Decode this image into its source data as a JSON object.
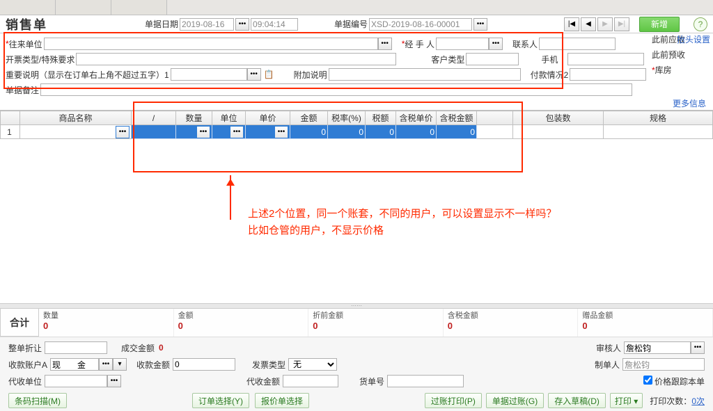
{
  "title": "销售单",
  "header": {
    "date_label": "单据日期",
    "date": "2019-08-16",
    "time": "09:04:14",
    "no_label": "单据编号",
    "no": "XSD-2019-08-16-00001",
    "new_btn": "新增"
  },
  "form": {
    "customer_label": "往来单位",
    "handler_label": "经 手 人",
    "contact_label": "联系人",
    "invoice_label": "开票类型/特殊要求",
    "cust_type_label": "客户类型",
    "phone_label": "手机",
    "important_label": "重要说明（显示在订单右上角不超过五字）1",
    "extra_label": "附加说明",
    "pay_state_label": "付款情况2",
    "note_label": "单据备注",
    "more_info": "更多信息",
    "side_receivable": "此前应收",
    "side_settings": "抬头设置",
    "side_prepaid": "此前预收",
    "side_stock": "库房"
  },
  "grid": {
    "cols": [
      "",
      "商品名称",
      "/",
      "数量",
      "单位",
      "单价",
      "金额",
      "税率(%)",
      "税额",
      "含税单价",
      "含税金额",
      "",
      "包装数",
      "规格"
    ],
    "row1": {
      "idx": "1",
      "amount": "0",
      "tax": "0",
      "tax_amt": "0",
      "pt": "0",
      "gt": "0"
    }
  },
  "totals": {
    "label": "合计",
    "qty": {
      "k": "数量",
      "v": "0"
    },
    "amount": {
      "k": "金额",
      "v": "0"
    },
    "pre_amount": {
      "k": "折前金额",
      "v": "0"
    },
    "gross": {
      "k": "含税金额",
      "v": "0"
    },
    "gift": {
      "k": "赠品金额",
      "v": "0"
    }
  },
  "footer": {
    "discount_label": "整单折让",
    "deal_label": "成交金额",
    "deal_val": "0",
    "auditor_label": "审核人",
    "auditor": "詹松钧",
    "acct_label": "收款账户A",
    "acct_val": "现　　金",
    "recv_label": "收款金额",
    "recv_val": "0",
    "invtype_label": "发票类型",
    "invtype_val": "无",
    "maker_label": "制单人",
    "maker": "詹松钧",
    "agent_label": "代收单位",
    "agent_amt_label": "代收金额",
    "shipno_label": "货单号",
    "follow_cost": "价格跟踪本单",
    "barcode_btn": "条码扫描(M)",
    "order_sel_btn": "订单选择(Y)",
    "quote_sel_btn": "报价单选择",
    "post_print_btn": "过账打印(P)",
    "post_btn": "单据过账(G)",
    "draft_btn": "存入草稿(D)",
    "print_btn": "打印",
    "print_count_label": "打印次数：",
    "print_count": "0次"
  },
  "annotation": {
    "line1": "上述2个位置，同一个账套，不同的用户，可以设置显示不一样吗？",
    "line2": "比如仓管的用户，不显示价格"
  }
}
